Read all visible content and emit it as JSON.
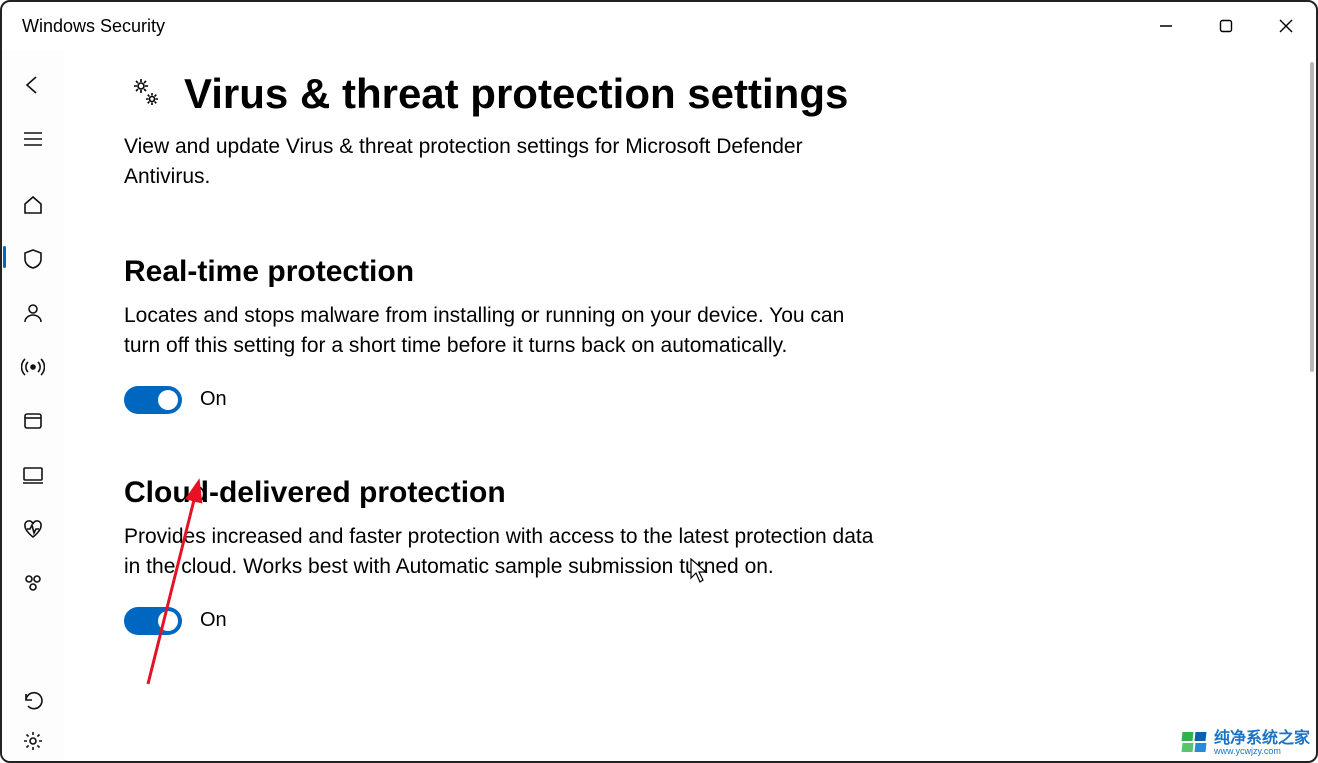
{
  "window": {
    "title": "Windows Security"
  },
  "sidebar": {
    "items": [
      {
        "id": "back",
        "icon": "arrow-left-icon"
      },
      {
        "id": "menu",
        "icon": "hamburger-icon"
      },
      {
        "id": "home",
        "icon": "home-icon"
      },
      {
        "id": "virus",
        "icon": "shield-icon",
        "active": true
      },
      {
        "id": "account",
        "icon": "person-icon"
      },
      {
        "id": "firewall",
        "icon": "broadcast-icon"
      },
      {
        "id": "app-browser",
        "icon": "window-icon"
      },
      {
        "id": "device-security",
        "icon": "monitor-icon"
      },
      {
        "id": "performance",
        "icon": "heart-rate-icon"
      },
      {
        "id": "family",
        "icon": "family-icon"
      }
    ],
    "bottom": [
      {
        "id": "history",
        "icon": "history-icon"
      },
      {
        "id": "settings",
        "icon": "gear-icon"
      }
    ]
  },
  "page": {
    "title": "Virus & threat protection settings",
    "subtitle": "View and update Virus & threat protection settings for Microsoft Defender Antivirus."
  },
  "sections": {
    "realtime": {
      "heading": "Real-time protection",
      "description": "Locates and stops malware from installing or running on your device. You can turn off this setting for a short time before it turns back on automatically.",
      "toggle_state": "On",
      "toggle_on": true
    },
    "cloud": {
      "heading": "Cloud-delivered protection",
      "description": "Provides increased and faster protection with access to the latest protection data in the cloud. Works best with Automatic sample submission turned on.",
      "toggle_state": "On",
      "toggle_on": true
    }
  },
  "colors": {
    "accent": "#0067c0"
  },
  "watermark": {
    "line1": "纯净系统之家",
    "line2": "www.ycwjzy.com"
  }
}
